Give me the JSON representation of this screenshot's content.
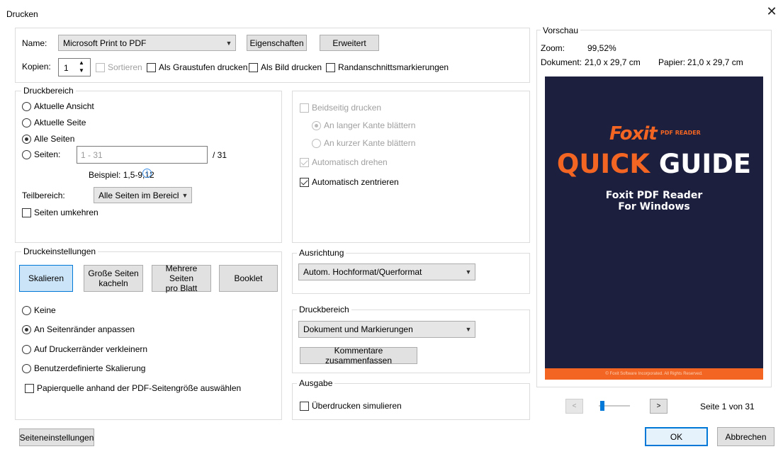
{
  "window": {
    "title": "Drucken",
    "close_glyph": "✕"
  },
  "printer": {
    "name_label": "Name:",
    "selected_printer": "Microsoft Print to PDF",
    "properties_button": "Eigenschaften",
    "advanced_button": "Erweitert",
    "copies_label": "Kopien:",
    "copies_value": "1",
    "collate_label": "Sortieren",
    "grayscale_label": "Als Graustufen drucken",
    "as_image_label": "Als Bild drucken",
    "crop_marks_label": "Randanschnittsmarkierungen"
  },
  "print_range": {
    "legend": "Druckbereich",
    "current_view": "Aktuelle Ansicht",
    "current_page": "Aktuelle Seite",
    "all_pages": "Alle Seiten",
    "pages_label": "Seiten:",
    "pages_placeholder": "1 - 31",
    "pages_total": "/ 31",
    "example": "Beispiel: 1,5-9,12",
    "subset_label": "Teilbereich:",
    "subset_value": "Alle Seiten im Bereich",
    "reverse_pages": "Seiten umkehren"
  },
  "duplex": {
    "duplex_label": "Beidseitig drucken",
    "long_edge": "An langer Kante blättern",
    "short_edge": "An kurzer Kante blättern",
    "auto_rotate": "Automatisch drehen",
    "auto_center": "Automatisch zentrieren"
  },
  "print_settings": {
    "legend": "Druckeinstellungen",
    "tab_scale": "Skalieren",
    "tab_tile_line1": "Große Seiten",
    "tab_tile_line2": "kacheln",
    "tab_multiple_line1": "Mehrere Seiten",
    "tab_multiple_line2": "pro Blatt",
    "tab_booklet": "Booklet",
    "opt_none": "Keine",
    "opt_fit": "An Seitenränder anpassen",
    "opt_shrink": "Auf Druckerränder verkleinern",
    "opt_custom": "Benutzerdefinierte Skalierung",
    "paper_source": "Papierquelle anhand der PDF-Seitengröße auswählen"
  },
  "orientation": {
    "legend": "Ausrichtung",
    "value": "Autom. Hochformat/Querformat"
  },
  "print_what": {
    "legend": "Druckbereich",
    "value": "Dokument und Markierungen",
    "summarize_button": "Kommentare zusammenfassen"
  },
  "output": {
    "legend": "Ausgabe",
    "simulate_overprint": "Überdrucken simulieren"
  },
  "preview": {
    "legend": "Vorschau",
    "zoom_label": "Zoom:",
    "zoom_value": "99,52%",
    "document_label": "Dokument:",
    "document_value": "21,0 x 29,7 cm",
    "paper_label": "Papier:",
    "paper_value": "21,0 x 29,7 cm",
    "cover_logo": "Foxit",
    "cover_logo_sub": "PDF READER",
    "cover_title_1": "QUICK",
    "cover_title_2": "GUIDE",
    "cover_subtitle_1": "Foxit PDF Reader",
    "cover_subtitle_2": "For Windows",
    "cover_footer": "© Foxit Software Incorporated. All Rights Reserved.",
    "prev_glyph": "<",
    "next_glyph": ">",
    "page_indicator": "Seite 1 von 31"
  },
  "footer": {
    "page_setup_button": "Seiteneinstellungen",
    "ok_button": "OK",
    "cancel_button": "Abbrechen"
  },
  "colors": {
    "accent": "#0078d7",
    "cover_bg": "#1d1f3e",
    "brand_orange": "#f26522"
  }
}
